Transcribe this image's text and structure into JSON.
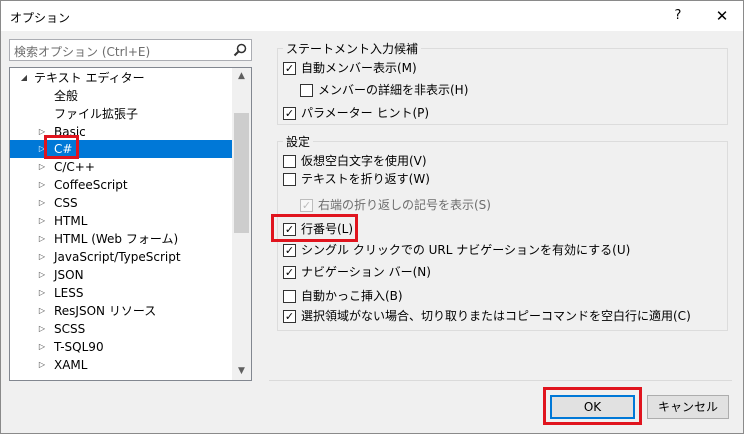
{
  "window": {
    "title": "オプション"
  },
  "titlebar": {
    "help_label": "?",
    "close_label": "✕"
  },
  "search": {
    "placeholder": "検索オプション (Ctrl+E)"
  },
  "tree": {
    "root": "テキスト エディター",
    "items": [
      {
        "label": "全般",
        "has_children": false
      },
      {
        "label": "ファイル拡張子",
        "has_children": false
      },
      {
        "label": "Basic",
        "has_children": true
      },
      {
        "label": "C#",
        "has_children": true,
        "selected": true
      },
      {
        "label": "C/C++",
        "has_children": true
      },
      {
        "label": "CoffeeScript",
        "has_children": true
      },
      {
        "label": "CSS",
        "has_children": true
      },
      {
        "label": "HTML",
        "has_children": true
      },
      {
        "label": "HTML (Web フォーム)",
        "has_children": true
      },
      {
        "label": "JavaScript/TypeScript",
        "has_children": true
      },
      {
        "label": "JSON",
        "has_children": true
      },
      {
        "label": "LESS",
        "has_children": true
      },
      {
        "label": "ResJSON リソース",
        "has_children": true
      },
      {
        "label": "SCSS",
        "has_children": true
      },
      {
        "label": "T-SQL90",
        "has_children": true
      },
      {
        "label": "XAML",
        "has_children": true
      }
    ]
  },
  "statement_group": {
    "title": "ステートメント入力候補",
    "options": [
      {
        "label": "自動メンバー表示(M)",
        "checked": true
      },
      {
        "label": "メンバーの詳細を非表示(H)",
        "checked": false
      },
      {
        "label": "パラメーター ヒント(P)",
        "checked": true
      }
    ]
  },
  "settings_group": {
    "title": "設定",
    "options": [
      {
        "label": "仮想空白文字を使用(V)",
        "checked": false
      },
      {
        "label": "テキストを折り返す(W)",
        "checked": false
      },
      {
        "label": "右端の折り返しの記号を表示(S)",
        "checked": true,
        "disabled": true
      },
      {
        "label": "行番号(L)",
        "checked": true
      },
      {
        "label": "シングル クリックでの URL ナビゲーションを有効にする(U)",
        "checked": true
      },
      {
        "label": "ナビゲーション バー(N)",
        "checked": true
      },
      {
        "label": "自動かっこ挿入(B)",
        "checked": false
      },
      {
        "label": "選択領域がない場合、切り取りまたはコピーコマンドを空白行に適用(C)",
        "checked": true
      }
    ]
  },
  "buttons": {
    "ok": "OK",
    "cancel": "キャンセル"
  },
  "colors": {
    "selection": "#0078d7",
    "highlight": "#e0141e"
  }
}
